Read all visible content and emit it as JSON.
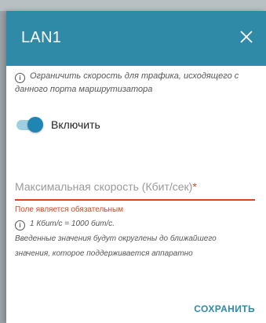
{
  "dialog": {
    "title": "LAN1",
    "info_text": "Ограничить скорость для трафика, исходящего с данного порта маршрутизатора",
    "toggle": {
      "label": "Включить",
      "state": "on"
    },
    "speed_field": {
      "label": "Максимальная скорость (Кбит/сек)",
      "required_mark": "*",
      "value": ""
    },
    "error_text": "Поле является обязательным",
    "hint_unit": "1 Кбит/с = 1000 бит/с.",
    "hint_rounding": "Введенные значения будут округлены до ближайшего значения, которое поддерживается аппаратно",
    "save_label": "СОХРАНИТЬ"
  },
  "colors": {
    "header": "#2f8aa8",
    "accent": "#1f86b4",
    "error": "#e04020"
  },
  "icons": {
    "close": "close-icon",
    "info": "info-icon"
  }
}
